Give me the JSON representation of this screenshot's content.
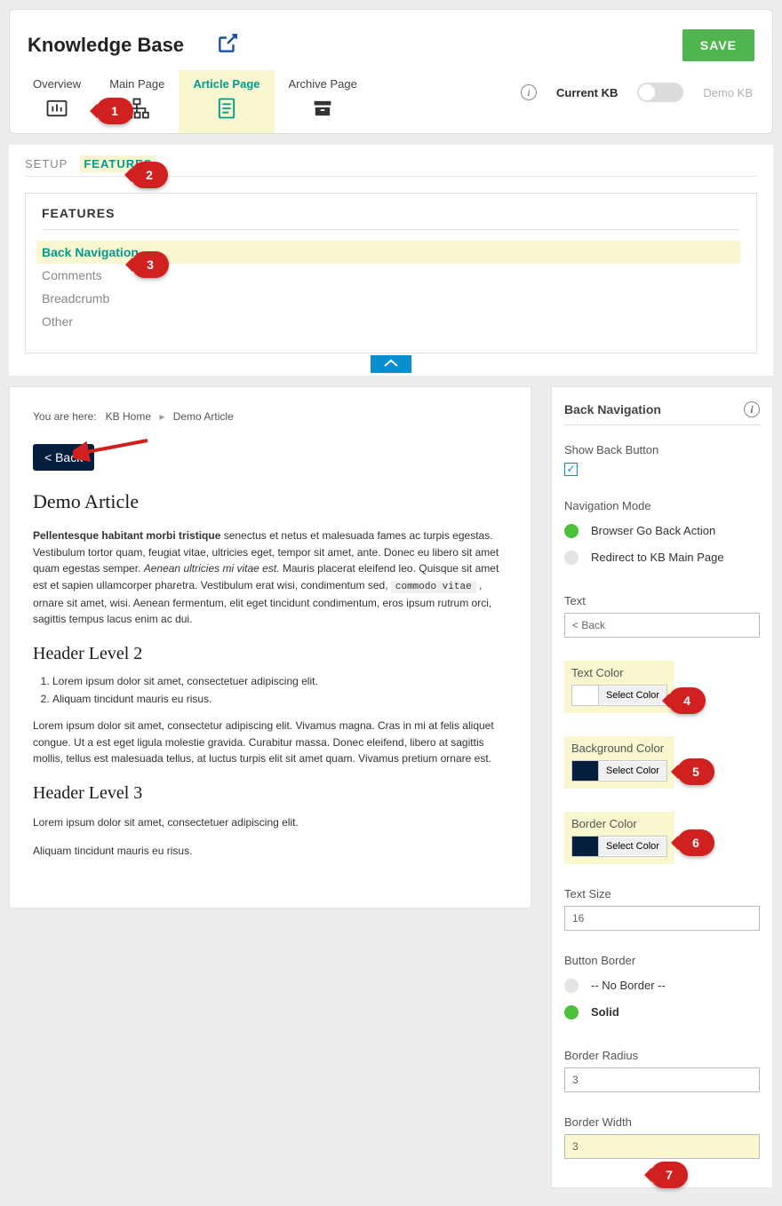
{
  "header": {
    "title": "Knowledge Base",
    "save_label": "SAVE",
    "current_kb_label": "Current KB",
    "demo_kb_label": "Demo KB"
  },
  "tabs": {
    "overview": "Overview",
    "main_page": "Main Page",
    "article_page": "Article Page",
    "archive_page": "Archive Page"
  },
  "subtabs": {
    "setup": "SETUP",
    "features": "FEATURES"
  },
  "features_panel": {
    "title": "FEATURES",
    "items": {
      "back_nav": "Back Navigation",
      "comments": "Comments",
      "breadcrumb": "Breadcrumb",
      "other": "Other"
    }
  },
  "preview": {
    "breadcrumb_prefix": "You are here:",
    "breadcrumb_home": "KB Home",
    "breadcrumb_article": "Demo Article",
    "back_label": "<  Back",
    "article_title": "Demo Article",
    "para1_lead": "Pellentesque habitant morbi tristique",
    "para1_rest": " senectus et netus et malesuada fames ac turpis egestas. Vestibulum tortor quam, feugiat vitae, ultricies eget, tempor sit amet, ante. Donec eu libero sit amet quam egestas semper. ",
    "para1_ital": "Aenean ultricies mi vitae est.",
    "para1_rest2": " Mauris placerat eleifend leo. Quisque sit amet est et sapien ullamcorper pharetra. Vestibulum erat wisi, condimentum sed, ",
    "para1_code": "commodo vitae",
    "para1_rest3": " , ornare sit amet, wisi. Aenean fermentum, elit eget tincidunt condimentum, eros ipsum rutrum orci, sagittis tempus lacus enim ac dui.",
    "h2": "Header Level 2",
    "li1": "Lorem ipsum dolor sit amet, consectetuer adipiscing elit.",
    "li2": "Aliquam tincidunt mauris eu risus.",
    "para2": "Lorem ipsum dolor sit amet, consectetur adipiscing elit. Vivamus magna. Cras in mi at felis aliquet congue. Ut a est eget ligula molestie gravida. Curabitur massa. Donec eleifend, libero at sagittis mollis, tellus est malesuada tellus, at luctus turpis elit sit amet quam. Vivamus pretium ornare est.",
    "h3": "Header Level 3",
    "para3a": "Lorem ipsum dolor sit amet, consectetuer adipiscing elit.",
    "para3b": "Aliquam tincidunt mauris eu risus."
  },
  "settings": {
    "panel_title": "Back Navigation",
    "show_back_label": "Show Back Button",
    "nav_mode_label": "Navigation Mode",
    "nav_opt1": "Browser Go Back Action",
    "nav_opt2": "Redirect to KB Main Page",
    "text_label": "Text",
    "text_value": "< Back",
    "text_color_label": "Text Color",
    "bg_color_label": "Background Color",
    "border_color_label": "Border Color",
    "select_color_btn": "Select Color",
    "text_size_label": "Text Size",
    "text_size_value": "16",
    "button_border_label": "Button Border",
    "border_opt1": "-- No Border --",
    "border_opt2": "Solid",
    "border_radius_label": "Border Radius",
    "border_radius_value": "3",
    "border_width_label": "Border Width",
    "border_width_value": "3"
  },
  "colors": {
    "text_color": "#ffffff",
    "bg_color": "#041e3e",
    "border_color": "#041e3e"
  },
  "callouts": {
    "c1": "1",
    "c2": "2",
    "c3": "3",
    "c4": "4",
    "c5": "5",
    "c6": "6",
    "c7": "7"
  }
}
